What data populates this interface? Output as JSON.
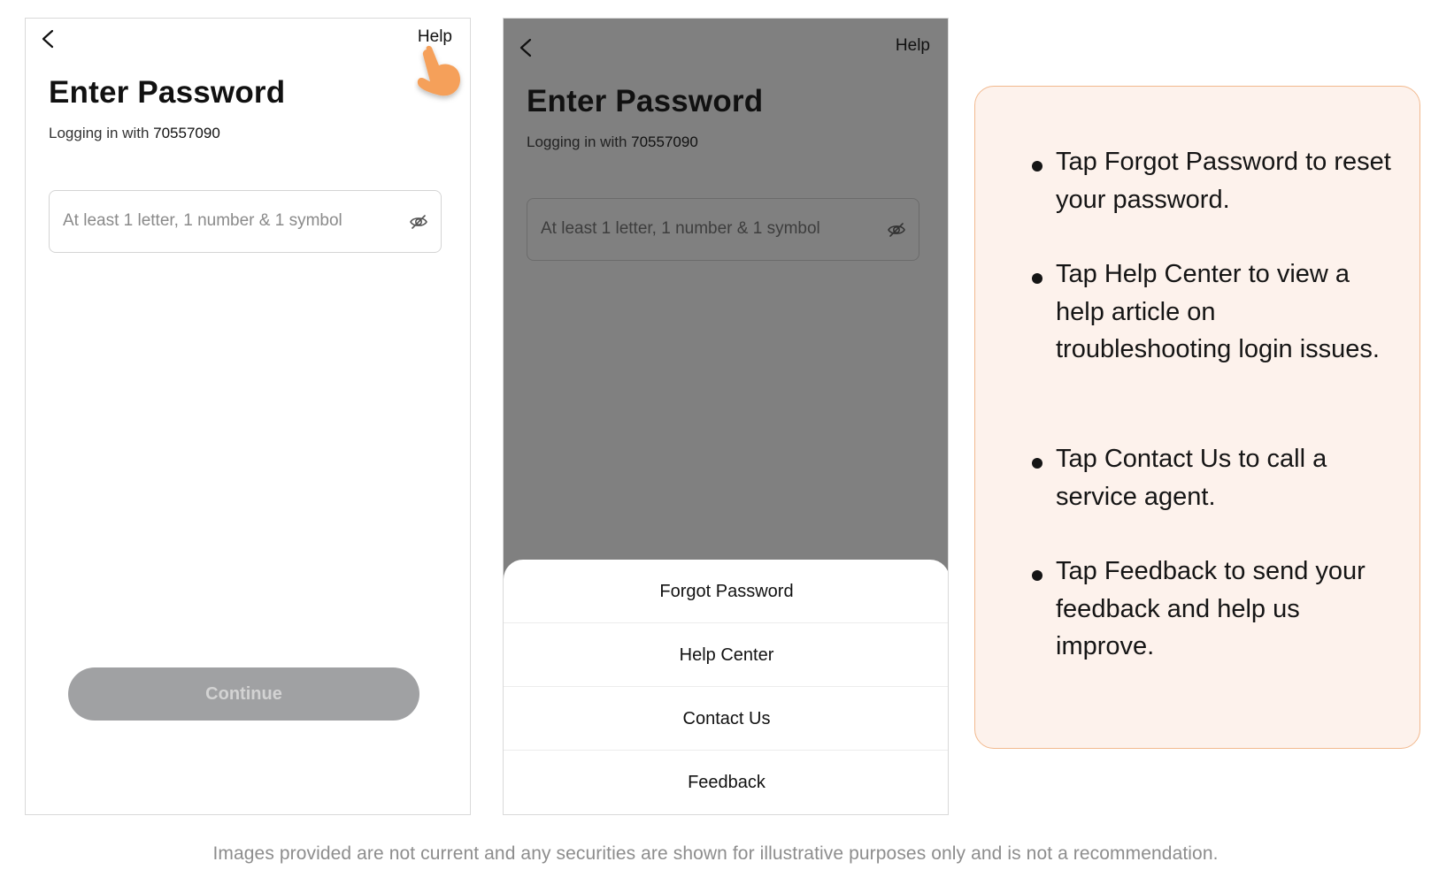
{
  "screen_before": {
    "help_label": "Help",
    "title": "Enter Password",
    "login_prefix": "Logging in with ",
    "login_number": "70557090",
    "password_placeholder": "At least 1 letter, 1 number & 1 symbol",
    "continue_label": "Continue"
  },
  "screen_after": {
    "help_label": "Help",
    "title": "Enter Password",
    "login_prefix": "Logging in with ",
    "login_number": "70557090",
    "password_placeholder": "At least 1 letter, 1 number & 1 symbol",
    "menu": [
      {
        "label": "Forgot Password"
      },
      {
        "label": "Help Center"
      },
      {
        "label": "Contact Us"
      },
      {
        "label": "Feedback"
      }
    ]
  },
  "tips": [
    "Tap Forgot Password to reset your password.",
    "Tap Help Center to view a help article on troubleshooting login issues.",
    "Tap Contact Us to call a service agent.",
    "Tap Feedback to send your feedback and help us improve."
  ],
  "disclaimer": "Images provided are not current and any securities are shown for illustrative purposes only and is not a recommendation.",
  "icons": {
    "back": "chevron-left-icon",
    "eye": "eye-slash-icon",
    "hand": "pointing-hand-icon"
  },
  "colors": {
    "accent_orange": "#f5a05a",
    "card_background": "#fdf2ec",
    "card_border": "#f2b98e",
    "overlay_gray": "#808080",
    "disabled_button": "#a0a1a3"
  }
}
